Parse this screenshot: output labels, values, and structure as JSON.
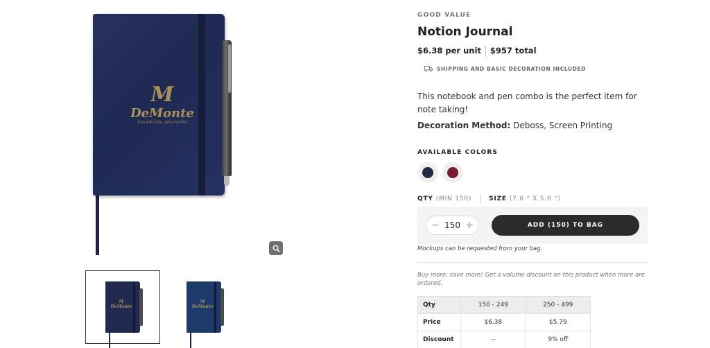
{
  "product": {
    "eyebrow": "GOOD VALUE",
    "title": "Notion Journal",
    "unit_price": "$6.38 per unit",
    "total_price": "$957 total",
    "shipping_note": "SHIPPING AND BASIC DECORATION INCLUDED",
    "description": "This notebook and pen combo is the perfect item for note taking!",
    "decoration_label": "Decoration Method:",
    "decoration_value": "Deboss, Screen Printing"
  },
  "imprint": {
    "monogram": "M",
    "brand": "DeMonte",
    "tagline": "FINANCIAL ADVISORS"
  },
  "colors": {
    "label": "AVAILABLE COLORS",
    "swatches": [
      {
        "name": "navy",
        "hex": "#232a45"
      },
      {
        "name": "burgundy",
        "hex": "#7a1a35"
      }
    ]
  },
  "thumbnails": [
    {
      "name": "navy",
      "hex": "#232a4f"
    },
    {
      "name": "blue",
      "hex": "#1e3a6b"
    }
  ],
  "order": {
    "qty_label": "QTY",
    "qty_min": "(MIN 150)",
    "size_label": "SIZE",
    "size_value": "(7.0 \" X 5.0 \")",
    "quantity": "150",
    "minus": "−",
    "plus": "+",
    "add_button": "ADD (150) TO BAG",
    "mockup_note": "Mockups can be requested from your bag."
  },
  "volume": {
    "note": "Buy more, save more! Get a volume discount on this product when more are ordered.",
    "rows": [
      {
        "label": "Qty",
        "values": [
          "150 - 249",
          "250 - 499"
        ]
      },
      {
        "label": "Price",
        "values": [
          "$6.38",
          "$5.79"
        ]
      },
      {
        "label": "Discount",
        "values": [
          "--",
          "9% off"
        ]
      }
    ]
  }
}
